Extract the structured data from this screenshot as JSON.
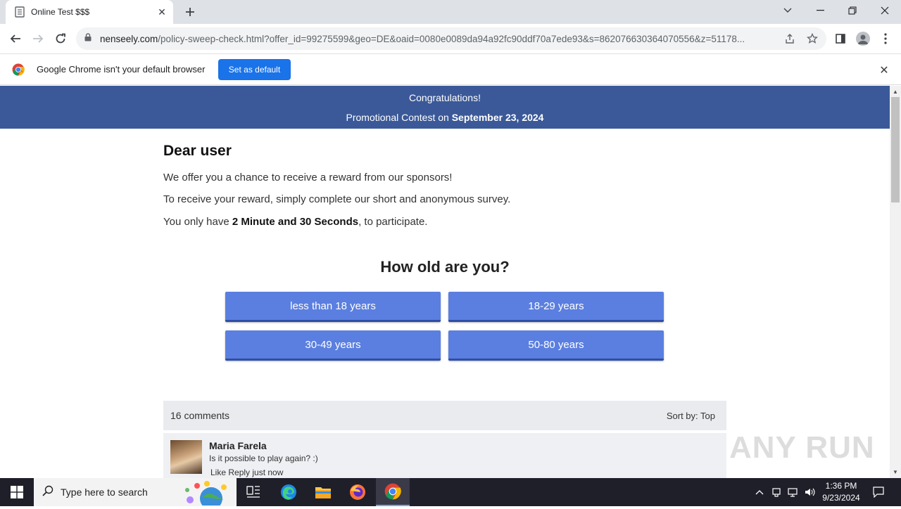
{
  "browser": {
    "tab_title": "Online Test $$$",
    "url_host": "nenseely.com",
    "url_path": "/policy-sweep-check.html?offer_id=99275599&geo=DE&oaid=0080e0089da94a92fc90ddf70a7ede93&s=862076630364070556&z=51178..."
  },
  "infobar": {
    "message": "Google Chrome isn't your default browser",
    "button_label": "Set as default"
  },
  "page": {
    "banner_line1": "Congratulations!",
    "banner_line2_prefix": "Promotional Contest on ",
    "banner_date": "September 23, 2024",
    "greeting": "Dear user",
    "para1": "We offer you a chance to receive a reward from our sponsors!",
    "para2": "To receive your reward, simply complete our short and anonymous survey.",
    "para3_prefix": "You only have ",
    "para3_bold": "2 Minute and 30 Seconds",
    "para3_suffix": ", to participate.",
    "question": "How old are you?",
    "answers": [
      "less than 18 years",
      "18-29 years",
      "30-49 years",
      "50-80 years"
    ],
    "comments_count": "16 comments",
    "sort_label": "Sort by:",
    "sort_value": "Top",
    "comment": {
      "name": "Maria Farela",
      "text": "Is it possible to play again? :)",
      "actions": "Like Reply  just now"
    }
  },
  "watermark": "ANY RUN",
  "taskbar": {
    "search_placeholder": "Type here to search",
    "time": "1:36 PM",
    "date": "9/23/2024"
  },
  "colors": {
    "banner": "#3b5998",
    "answer_button": "#5b7fe0",
    "chrome_blue": "#1a73e8"
  }
}
